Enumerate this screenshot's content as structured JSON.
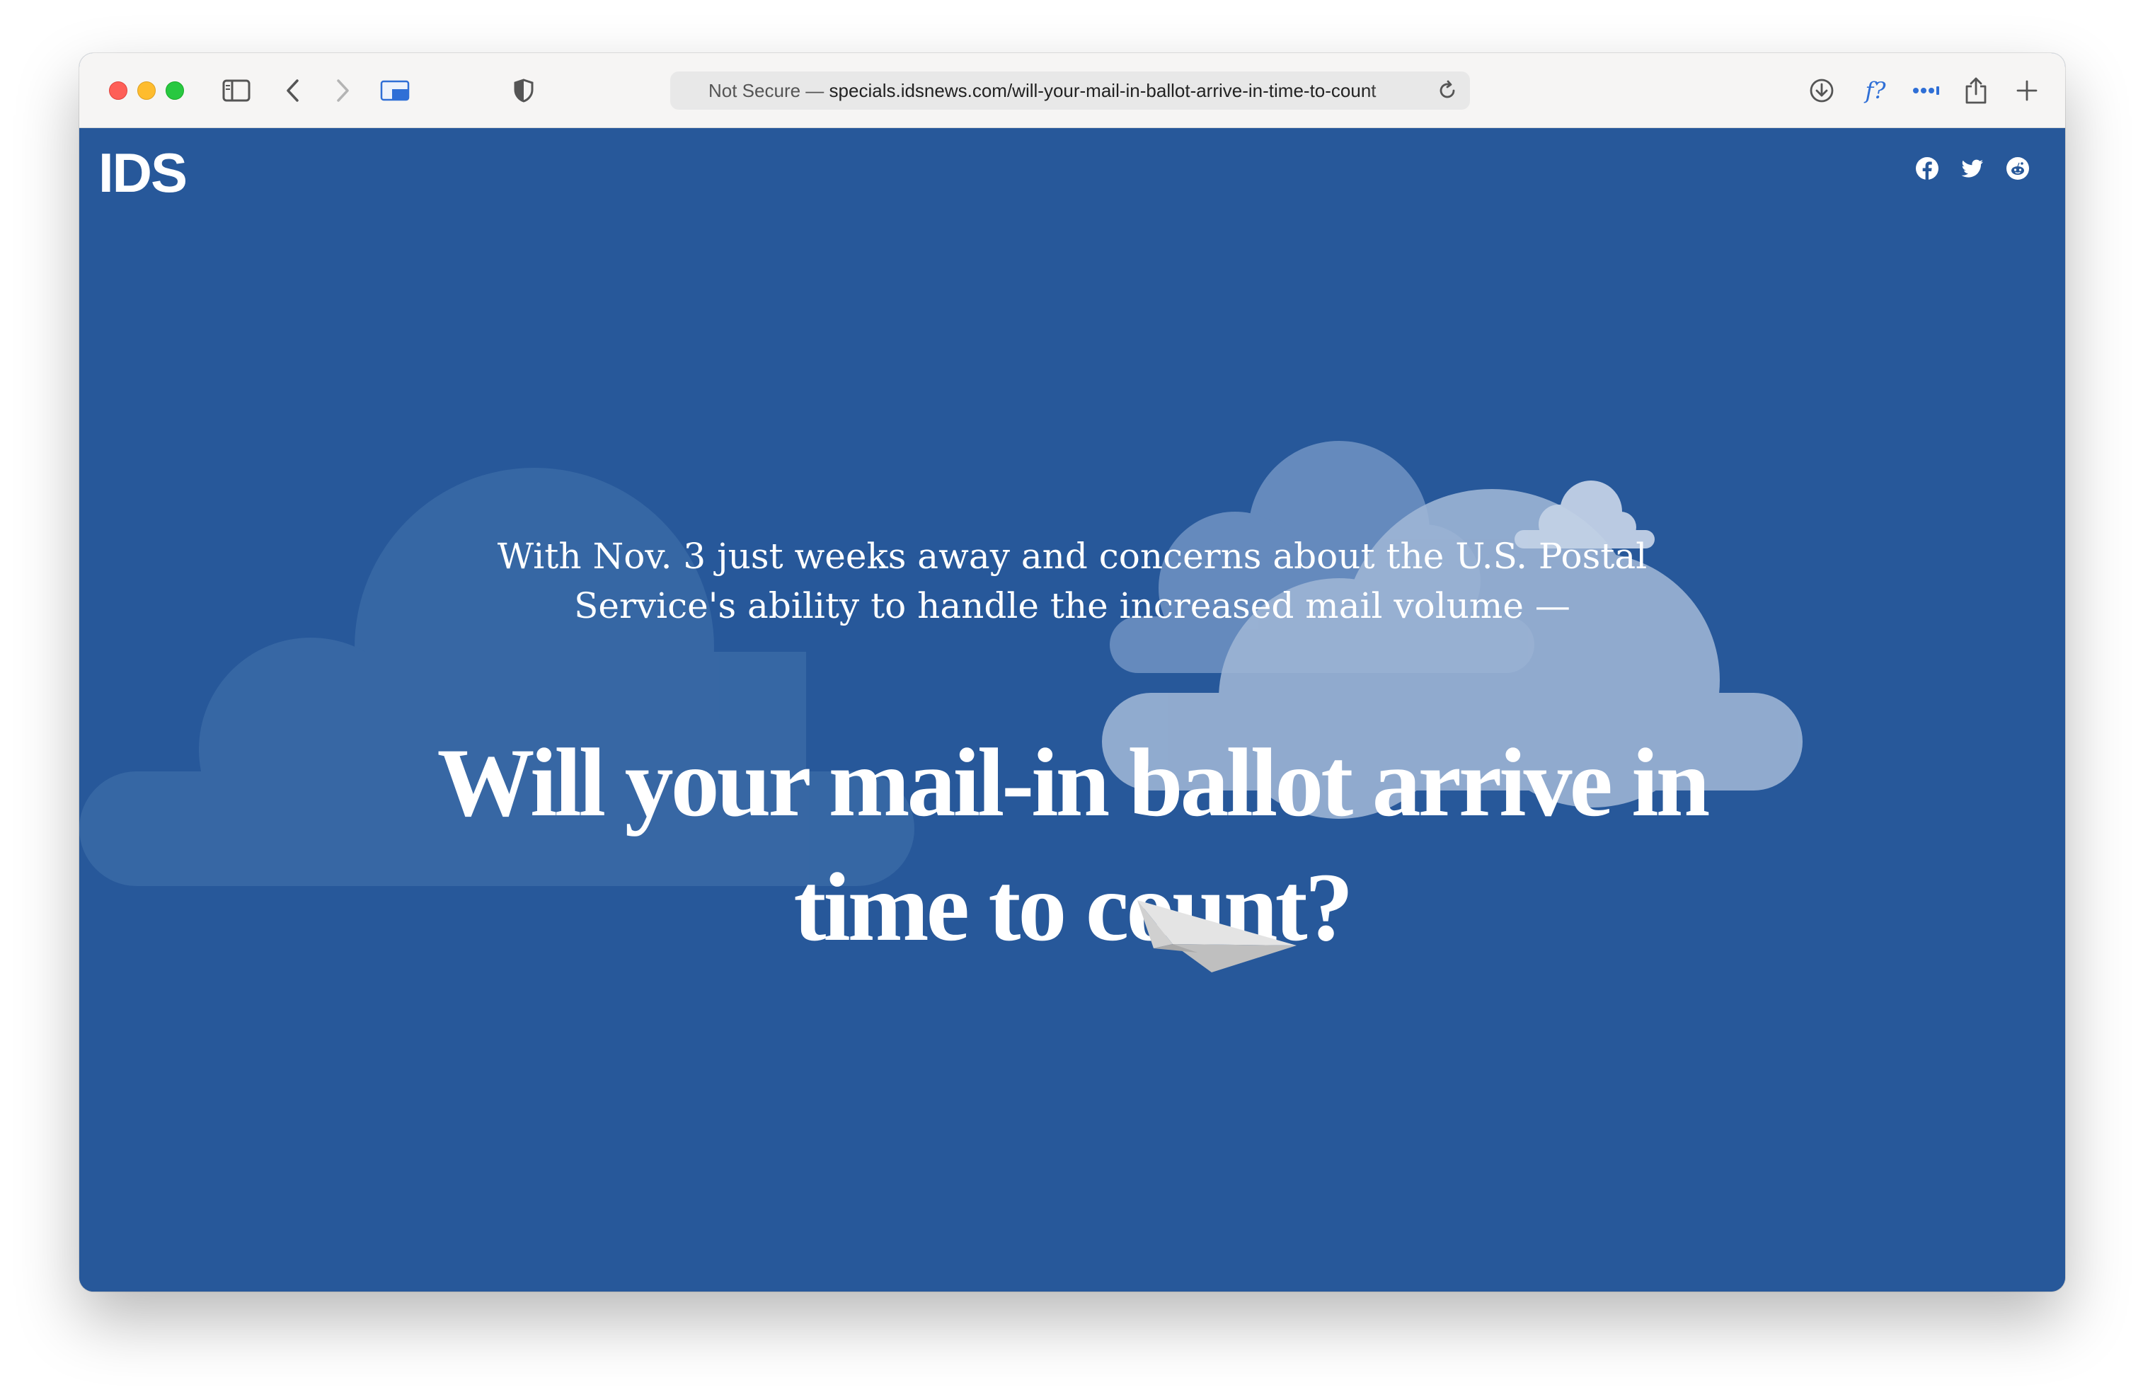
{
  "browser": {
    "address": {
      "security_label": "Not Secure —",
      "url": "specials.idsnews.com/will-your-mail-in-ballot-arrive-in-time-to-count"
    },
    "icons": [
      "sidebar-icon",
      "back-icon",
      "forward-icon",
      "tab-overview-icon",
      "privacy-shield-icon",
      "reload-icon",
      "download-icon",
      "font-query-icon",
      "more-icon",
      "share-icon",
      "new-tab-icon"
    ],
    "extension_label": "f?"
  },
  "site": {
    "logo": "IDS",
    "social": [
      "facebook-icon",
      "twitter-icon",
      "reddit-icon"
    ],
    "intro": "With Nov. 3 just weeks away and concerns about the U.S. Postal Service's ability to handle the increased mail volume —",
    "headline": "Will your mail-in ballot arrive in time to count?"
  },
  "colors": {
    "page_background": "#27589a",
    "text": "#ffffff",
    "cloud_dark": "#3a6aa6",
    "cloud_mid": "#6b8fc0",
    "cloud_light": "#9fb6d6"
  }
}
